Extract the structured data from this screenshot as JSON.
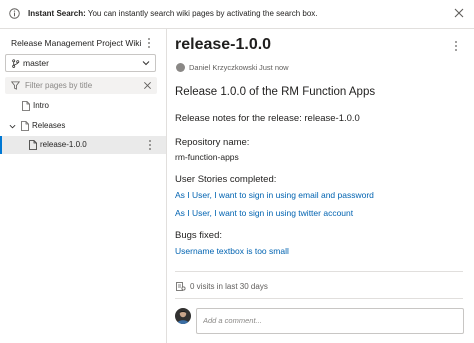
{
  "infobar": {
    "title": "Instant Search:",
    "message": " You can instantly search wiki pages by activating the search box.",
    "info_icon": "info-icon",
    "close_icon": "close-icon"
  },
  "sidebar": {
    "wiki_title": "Release Management Project Wiki",
    "branch": "master",
    "filter_placeholder": "Filter pages by title",
    "tree": [
      {
        "label": "Intro",
        "level": 1,
        "expanded": null,
        "selected": false
      },
      {
        "label": "Releases",
        "level": 1,
        "expanded": true,
        "selected": false
      },
      {
        "label": "release-1.0.0",
        "level": 2,
        "expanded": null,
        "selected": true
      }
    ]
  },
  "page": {
    "title": "release-1.0.0",
    "author": "Daniel Krzyczkowski",
    "time": "Just now",
    "heading": "Release 1.0.0 of the RM Function Apps",
    "notes_intro": "Release notes for the release: release-1.0.0",
    "repo_label": "Repository name:",
    "repo_name": "rm-function-apps",
    "stories_label": "User Stories completed:",
    "stories": [
      "As I User, I want to sign in using email and password",
      "As I User, I want to sign in using twitter account"
    ],
    "bugs_label": "Bugs fixed:",
    "bugs": [
      "Username textbox is too small"
    ],
    "visits": "0 visits in last 30 days",
    "comment_placeholder": "Add a comment..."
  },
  "colors": {
    "accent": "#0078d4",
    "link": "#0063b1"
  }
}
